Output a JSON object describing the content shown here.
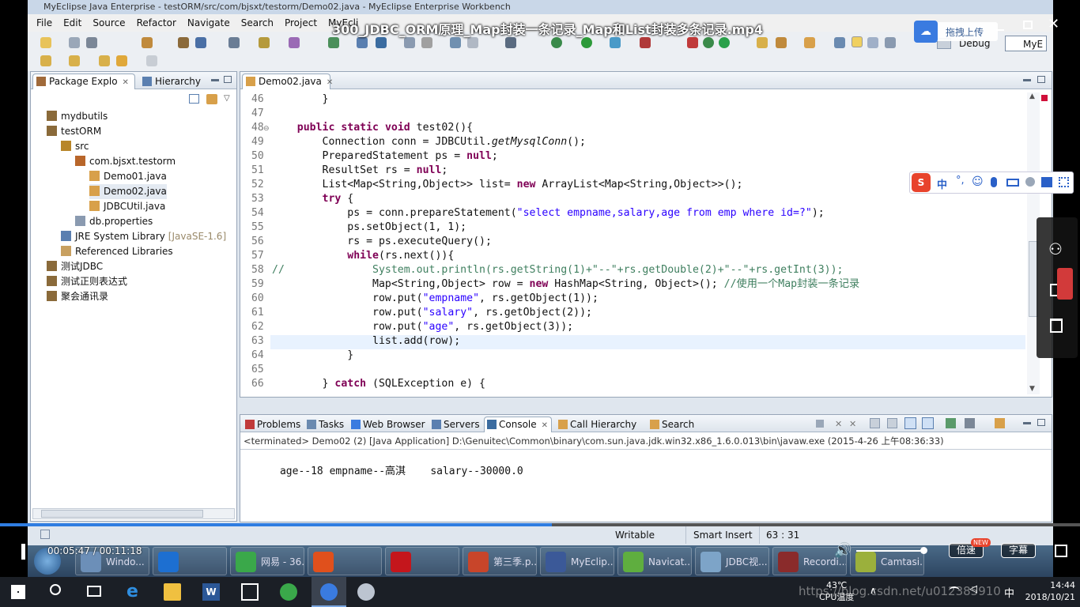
{
  "window": {
    "title": "MyEclipse Java Enterprise - testORM/src/com/bjsxt/testorm/Demo02.java - MyEclipse Enterprise Workbench"
  },
  "video": {
    "title": "300_JDBC_ORM原理_Map封装一条记录_Map和List封装多条记录.mp4",
    "upload_label": "拖拽上传",
    "current_time": "00:05:47",
    "total_time": "00:11:18",
    "time_sep": " / ",
    "speed_label": "倍速",
    "speed_badge": "NEW",
    "subtitle_label": "字幕"
  },
  "menu": [
    "File",
    "Edit",
    "Source",
    "Refactor",
    "Navigate",
    "Search",
    "Project",
    "MyEcli"
  ],
  "perspective": {
    "debug": "Debug",
    "myeclipse": "MyE"
  },
  "package_explorer": {
    "tab_label": "Package Explo",
    "hierarchy_label": "Hierarchy",
    "tree": [
      {
        "label": "mydbutils",
        "level": 1
      },
      {
        "label": "testORM",
        "level": 1
      },
      {
        "label": "src",
        "level": 2
      },
      {
        "label": "com.bjsxt.testorm",
        "level": 3
      },
      {
        "label": "Demo01.java",
        "level": 4
      },
      {
        "label": "Demo02.java",
        "level": 4
      },
      {
        "label": "JDBCUtil.java",
        "level": 4
      },
      {
        "label": "db.properties",
        "level": 3
      },
      {
        "label": "JRE System Library",
        "suffix": "[JavaSE-1.6]",
        "level": 2
      },
      {
        "label": "Referenced Libraries",
        "level": 2
      },
      {
        "label": "测试JDBC",
        "level": 1
      },
      {
        "label": "测试正则表达式",
        "level": 1
      },
      {
        "label": "聚会通讯录",
        "level": 1
      }
    ]
  },
  "editor": {
    "tab_label": "Demo02.java",
    "lines": [
      {
        "n": "46",
        "html": "        }"
      },
      {
        "n": "47",
        "html": ""
      },
      {
        "n": "48",
        "html": "    <span class=\"kw\">public</span> <span class=\"kw\">static</span> <span class=\"kw\">void</span> test02(){"
      },
      {
        "n": "49",
        "html": "        Connection conn = JDBCUtil.<span class=\"it\">getMysqlConn</span>();"
      },
      {
        "n": "50",
        "html": "        PreparedStatement ps = <span class=\"kw\">null</span>;"
      },
      {
        "n": "51",
        "html": "        ResultSet rs = <span class=\"kw\">null</span>;"
      },
      {
        "n": "52",
        "html": "        List&lt;Map&lt;String,Object&gt;&gt; list= <span class=\"kw\">new</span> ArrayList&lt;Map&lt;String,Object&gt;&gt;();"
      },
      {
        "n": "53",
        "html": "        <span class=\"kw\">try</span> {"
      },
      {
        "n": "54",
        "html": "            ps = conn.prepareStatement(<span class=\"str\">\"select empname,salary,age from emp where id=?\"</span>);"
      },
      {
        "n": "55",
        "html": "            ps.setObject(1, 1);"
      },
      {
        "n": "56",
        "html": "            rs = ps.executeQuery();"
      },
      {
        "n": "57",
        "html": "            <span class=\"kw\">while</span>(rs.next()){"
      },
      {
        "n": "58",
        "html": "<span class=\"cm\">//              System.out.println(rs.getString(1)+\"--\"+rs.getDouble(2)+\"--\"+rs.getInt(3));</span>"
      },
      {
        "n": "59",
        "html": "                Map&lt;String,Object&gt; row = <span class=\"kw\">new</span> HashMap&lt;String, Object&gt;(); <span class=\"cm\">//使用一个Map封装一条记录</span>"
      },
      {
        "n": "60",
        "html": "                row.put(<span class=\"str\">\"empname\"</span>, rs.getObject(1));"
      },
      {
        "n": "61",
        "html": "                row.put(<span class=\"str\">\"salary\"</span>, rs.getObject(2));"
      },
      {
        "n": "62",
        "html": "                row.put(<span class=\"str\">\"age\"</span>, rs.getObject(3));"
      },
      {
        "n": "63",
        "html": "                list.add(row);"
      },
      {
        "n": "64",
        "html": "            }"
      },
      {
        "n": "65",
        "html": ""
      },
      {
        "n": "66",
        "html": "        } <span class=\"kw\">catch</span> (SQLException e) {"
      }
    ]
  },
  "bottom_tabs": [
    "Problems",
    "Tasks",
    "Web Browser",
    "Servers",
    "Console",
    "Call Hierarchy",
    "Search"
  ],
  "console": {
    "header": "<terminated> Demo02 (2) [Java Application] D:\\Genuitec\\Common\\binary\\com.sun.java.jdk.win32.x86_1.6.0.013\\bin\\javaw.exe (2015-4-26 上午08:36:33)",
    "output": "age--18 empname--高淇    salary--30000.0"
  },
  "statusbar": {
    "writable": "Writable",
    "insert_mode": "Smart Insert",
    "position": "63 : 31"
  },
  "win7_taskbar": [
    {
      "label": "Windo...",
      "color": "#6c8fb8"
    },
    {
      "label": "",
      "color": "#1d6fd1"
    },
    {
      "label": "网易 - 36...",
      "color": "#3aa84a"
    },
    {
      "label": "",
      "color": "#e0501c"
    },
    {
      "label": "",
      "color": "#c4161c"
    },
    {
      "label": "第三季.p...",
      "color": "#c8452a"
    },
    {
      "label": "MyEclip...",
      "color": "#3b5998"
    },
    {
      "label": "Navicat...",
      "color": "#5fae3f"
    },
    {
      "label": "JDBC视...",
      "color": "#7da4c8"
    },
    {
      "label": "Recordi...",
      "color": "#8a2b2b"
    },
    {
      "label": "Camtasi...",
      "color": "#9bb03c"
    }
  ],
  "ime_toolbar": {
    "label": "中"
  },
  "win10_tray": {
    "temp": "43℃",
    "temp_label": "CPU温度",
    "ime": "中",
    "time": "14:44",
    "date": "2018/10/21",
    "watermark": "https://blog.csdn.net/u012385910"
  }
}
